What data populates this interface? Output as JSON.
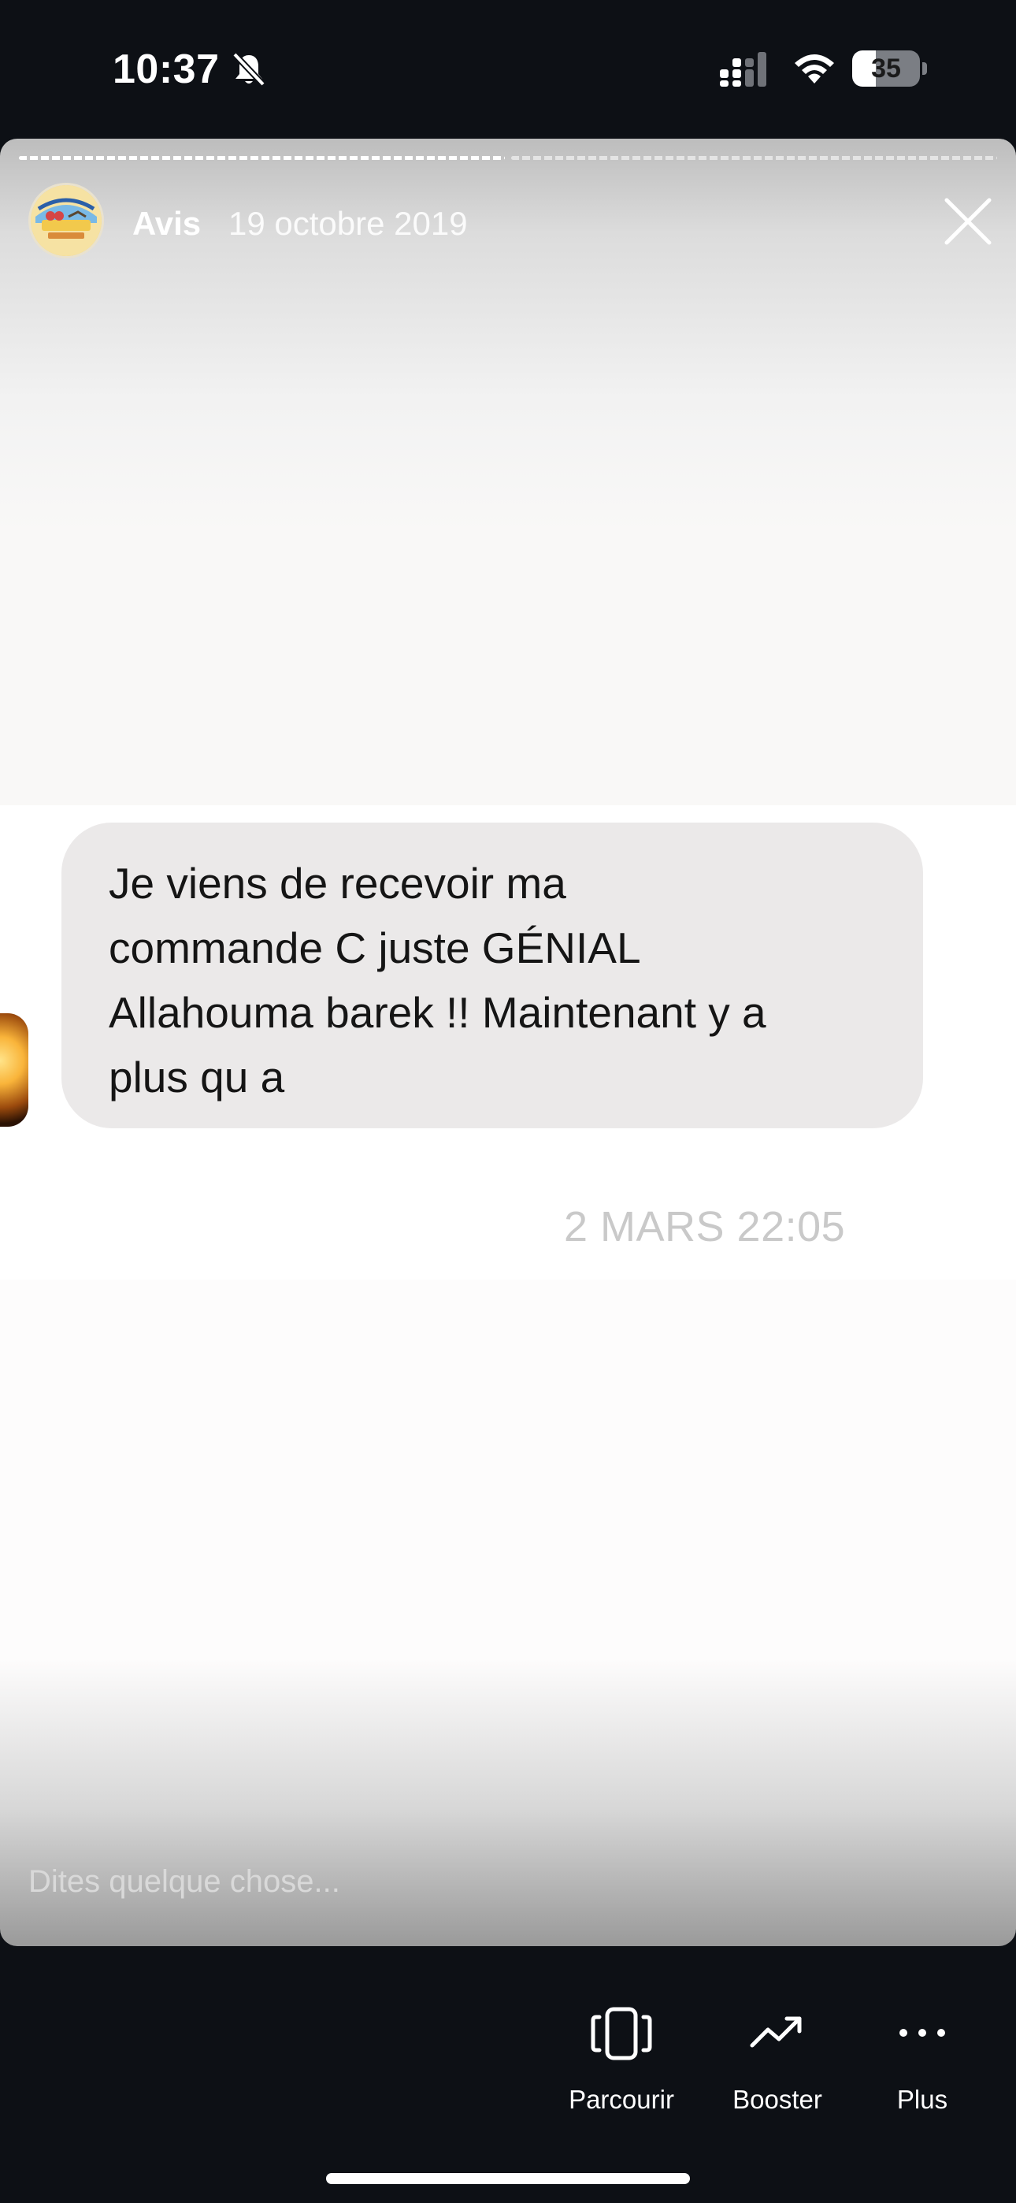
{
  "status_bar": {
    "time": "10:37",
    "battery_level": "35",
    "battery_fraction": 0.35,
    "icons": [
      "bell-slash-icon",
      "cellular-signal-icon",
      "wifi-icon",
      "battery-icon"
    ]
  },
  "story": {
    "account_name": "Avis",
    "date": "19 octobre 2019",
    "avatar_icon": "account-avatar-logo",
    "close_icon": "close-icon",
    "progress": {
      "segments": 2,
      "viewed": 1,
      "active_fraction": 1.0
    },
    "message": {
      "text_lines": [
        "Je viens de recevoir ma",
        "commande C juste GÉNIAL",
        "Allahouma barek !! Maintenant y a",
        "plus qu a"
      ],
      "timestamp": "2 MARS 22:05"
    },
    "reply_placeholder": "Dites quelque chose..."
  },
  "actions": [
    {
      "label": "Parcourir",
      "icon": "phone-browse-icon"
    },
    {
      "label": "Booster",
      "icon": "trend-up-icon"
    },
    {
      "label": "Plus",
      "icon": "more-dots-icon"
    }
  ],
  "colors": {
    "background": "#0d1015",
    "bubble": "#ebe9e9",
    "text_dark": "#151515",
    "timestamp": "#c9c9c9"
  }
}
